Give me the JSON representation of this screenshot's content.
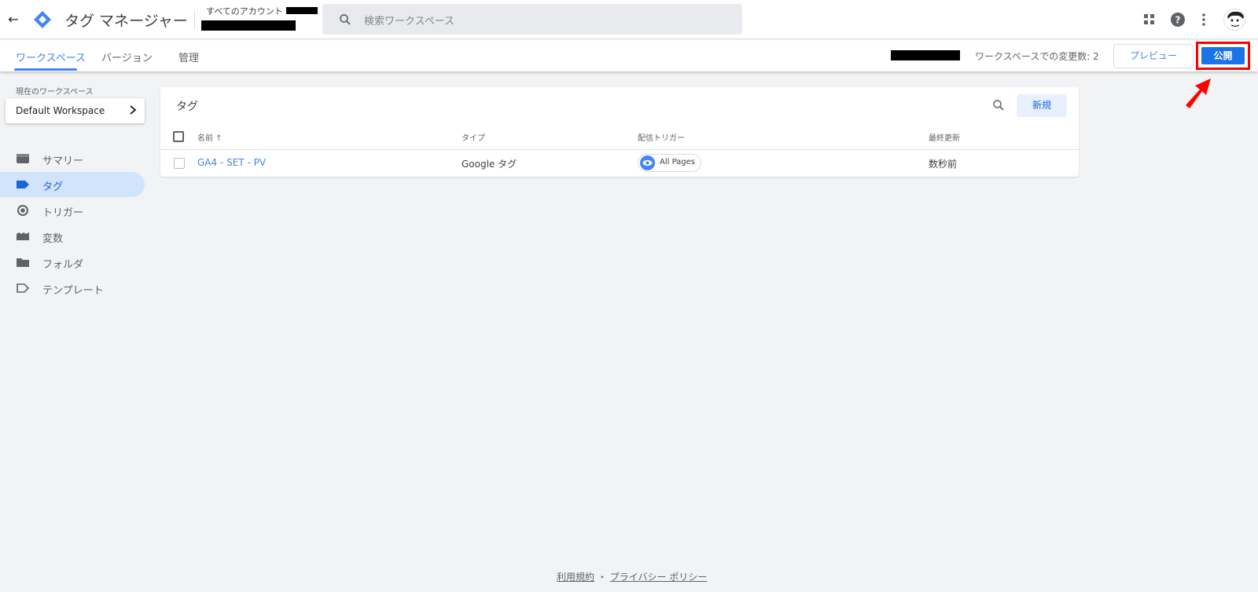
{
  "header": {
    "app_title": "タグ マネージャー",
    "breadcrumb_root": "すべてのアカウント >",
    "search_placeholder": "検索ワークスペース"
  },
  "subnav": {
    "tabs": [
      {
        "label": "ワークスペース",
        "active": true
      },
      {
        "label": "バージョン",
        "active": false
      },
      {
        "label": "管理",
        "active": false
      }
    ],
    "changes_text": "ワークスペースでの変更数: 2",
    "preview_label": "プレビュー",
    "publish_label": "公開"
  },
  "sidebar": {
    "workspace_heading": "現在のワークスペース",
    "workspace_name": "Default Workspace",
    "items": [
      {
        "label": "サマリー",
        "icon": "summary-icon",
        "active": false
      },
      {
        "label": "タグ",
        "icon": "tag-icon",
        "active": true
      },
      {
        "label": "トリガー",
        "icon": "trigger-icon",
        "active": false
      },
      {
        "label": "変数",
        "icon": "variables-icon",
        "active": false
      },
      {
        "label": "フォルダ",
        "icon": "folder-icon",
        "active": false
      },
      {
        "label": "テンプレート",
        "icon": "template-icon",
        "active": false
      }
    ]
  },
  "tags_card": {
    "title": "タグ",
    "new_label": "新規",
    "columns": [
      "名前 ↑",
      "タイプ",
      "配信トリガー",
      "最終更新"
    ],
    "rows": [
      {
        "name": "GA4 - SET - PV",
        "type": "Google タグ",
        "trigger": "All Pages",
        "updated": "数秒前"
      }
    ]
  },
  "footer": {
    "terms": "利用規約",
    "separator": "・",
    "privacy": "プライバシー ポリシー"
  },
  "colors": {
    "accent": "#4285f4",
    "publish": "#1a73e8",
    "highlight": "#ff0000"
  }
}
